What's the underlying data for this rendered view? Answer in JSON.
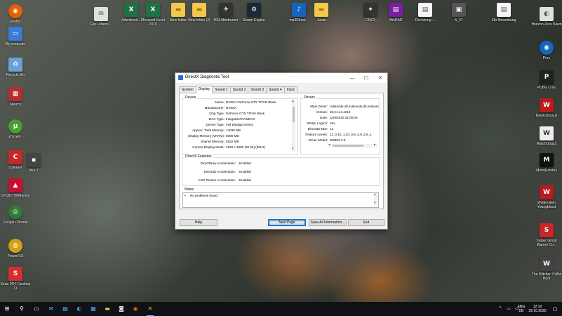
{
  "desktop": {
    "icons": [
      {
        "label": "Firefox",
        "color": "#e66000",
        "glyph": "◉"
      },
      {
        "label": "My computer",
        "color": "#3a7bd5",
        "glyph": "▭"
      },
      {
        "label": "Recycle Bin",
        "color": "#6aa0d8",
        "glyph": "♻"
      },
      {
        "label": "Speccy",
        "color": "#b03030",
        "glyph": "▦"
      },
      {
        "label": "uTorrent -",
        "color": "#4a9e2f",
        "glyph": "µ"
      },
      {
        "label": "ccleaner",
        "color": "#c62828",
        "glyph": "C"
      },
      {
        "label": "bike 1",
        "color": "#444444",
        "glyph": "▪"
      },
      {
        "label": "CPUID HWMonitor",
        "color": "#c8102e",
        "glyph": "▲"
      },
      {
        "label": "Google Chrome",
        "color": "#2e7d32",
        "glyph": "◎"
      },
      {
        "label": "PowerISO",
        "color": "#d4a017",
        "glyph": "◍"
      },
      {
        "label": "Soda PDF Desktop 11",
        "color": "#d32f2f",
        "glyph": "S"
      },
      {
        "label": "Elis Lebens...",
        "color": "#e0e0e0",
        "glyph": "✉"
      },
      {
        "label": "Arbeitszeit...",
        "color": "#1e7145",
        "glyph": "X"
      },
      {
        "label": "Microsoft Excel 2010",
        "color": "#1e7145",
        "glyph": "X"
      },
      {
        "label": "New folder",
        "color": "#f2c94c",
        "glyph": "▬"
      },
      {
        "label": "New folder (2)",
        "color": "#f2c94c",
        "glyph": "▬"
      },
      {
        "label": "MSI Afterburner",
        "color": "#333333",
        "glyph": "✈"
      },
      {
        "label": "Steam Engine",
        "color": "#1b2838",
        "glyph": "⚙"
      },
      {
        "label": "mp3Direct...",
        "color": "#1565c0",
        "glyph": "♪"
      },
      {
        "label": "Jucan",
        "color": "#f2c94c",
        "glyph": "▬"
      },
      {
        "label": "CNC3",
        "color": "#333333",
        "glyph": "✦"
      },
      {
        "label": "WinRAR",
        "color": "#7b1fa2",
        "glyph": "▤"
      },
      {
        "label": "Rechnung ...",
        "color": "#f5f5f5",
        "glyph": "▤"
      },
      {
        "label": "5_37",
        "color": "#555555",
        "glyph": "▣"
      },
      {
        "label": "Elis Bewerbung",
        "color": "#f5f5f5",
        "glyph": "▤"
      },
      {
        "label": "Horizon Zero Dawn",
        "color": "#e0e0e0",
        "glyph": "◐"
      },
      {
        "label": "Prey",
        "color": "#1565c0",
        "glyph": "◉"
      },
      {
        "label": "PUBG LITE",
        "color": "#222222",
        "glyph": "P"
      },
      {
        "label": "NewColossus",
        "color": "#b71c1c",
        "glyph": "W"
      },
      {
        "label": "WatchDogs2",
        "color": "#eeeeee",
        "glyph": "W"
      },
      {
        "label": "MetroExodus",
        "color": "#111111",
        "glyph": "M"
      },
      {
        "label": "Wolfenstein Youngblood",
        "color": "#b71c1c",
        "glyph": "W"
      },
      {
        "label": "Sniper Ghost Warrior Co...",
        "color": "#c62828",
        "glyph": "S"
      },
      {
        "label": "The Witcher 3 Wild Hunt",
        "color": "#444444",
        "glyph": "W"
      }
    ]
  },
  "window": {
    "title": "DirectX Diagnostic Tool",
    "controls": {
      "minimize": "—",
      "maximize": "☐",
      "close": "✕"
    },
    "tabs": [
      "System",
      "Display",
      "Sound 1",
      "Sound 2",
      "Sound 3",
      "Sound 4",
      "Input"
    ],
    "active_tab": "Display",
    "device": {
      "title": "Device",
      "rows": [
        {
          "key": "Name:",
          "value": "NVIDIA GeForce GTX TITAN Black"
        },
        {
          "key": "Manufacturer:",
          "value": "NVIDIA"
        },
        {
          "key": "Chip Type:",
          "value": "GeForce GTX TITAN Black"
        },
        {
          "key": "DAC Type:",
          "value": "Integrated RAMDAC"
        },
        {
          "key": "Device Type:",
          "value": "Full Display Device"
        },
        {
          "key": "Approx. Total Memory:",
          "value": "14038 MB"
        },
        {
          "key": "Display Memory (VRAM):",
          "value": "6096 MB"
        },
        {
          "key": "Shared Memory:",
          "value": "8162 MB"
        },
        {
          "key": "Current Display Mode:",
          "value": "1920 x 1080 (32 bit) (60Hz)"
        }
      ]
    },
    "drivers": {
      "title": "Drivers",
      "rows": [
        {
          "key": "Main Driver:",
          "value": "nvldumdx.dll,nvldumdx.dll,nvldumdx.c"
        },
        {
          "key": "Version:",
          "value": "26.21.14.4219"
        },
        {
          "key": "Date:",
          "value": "1/29/2020 02:00:00"
        },
        {
          "key": "WHQL Logo'd:",
          "value": "Yes"
        },
        {
          "key": "Direct3D DDI:",
          "value": "12"
        },
        {
          "key": "Feature Levels:",
          "value": "11_0,10_1,10_0,9_3,9_2,9_1"
        },
        {
          "key": "Driver Model:",
          "value": "WDDM 2.6"
        }
      ]
    },
    "features": {
      "title": "DirectX Features",
      "rows": [
        {
          "key": "DirectDraw Acceleration:",
          "value": "Enabled"
        },
        {
          "key": "Direct3D Acceleration:",
          "value": "Enabled"
        },
        {
          "key": "AGP Texture Acceleration:",
          "value": "Enabled"
        }
      ]
    },
    "notes": {
      "title": "Notes",
      "items": [
        "No problems found."
      ]
    },
    "buttons": {
      "help": "Help",
      "next_page": "Next Page",
      "save_all": "Save All Information...",
      "exit": "Exit"
    }
  },
  "taskbar": {
    "language": "ENG",
    "region": "DE",
    "time": "12:10",
    "date": "22.10.2020"
  }
}
